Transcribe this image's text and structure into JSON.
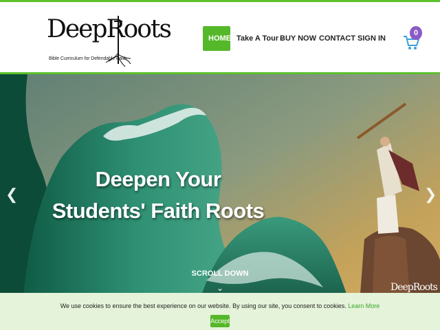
{
  "brand": {
    "logo_word": "DeepRoots",
    "tagline": "Bible Curriculum for Defendable Faith"
  },
  "nav": {
    "home": "HOME",
    "tour": "Take A Tour",
    "buy": "BUY NOW",
    "contact": "CONTACT",
    "signin": "SIGN IN",
    "cart_count": "0"
  },
  "hero": {
    "headline_line1": "Deepen Your",
    "headline_line2": "Students' Faith Roots",
    "scroll_label": "SCROLL DOWN",
    "watermark": "DeepRoots"
  },
  "cookie": {
    "message": "We use cookies to ensure the best experience on our website. By using our site, you consent to cookies.",
    "learn_more": "Learn More",
    "accept": "Accept"
  },
  "colors": {
    "accent": "#55b82a",
    "badge": "#8a5bc7"
  },
  "icons": [
    "cart-icon",
    "chevron-left-icon",
    "chevron-right-icon",
    "chevron-down-icon"
  ]
}
